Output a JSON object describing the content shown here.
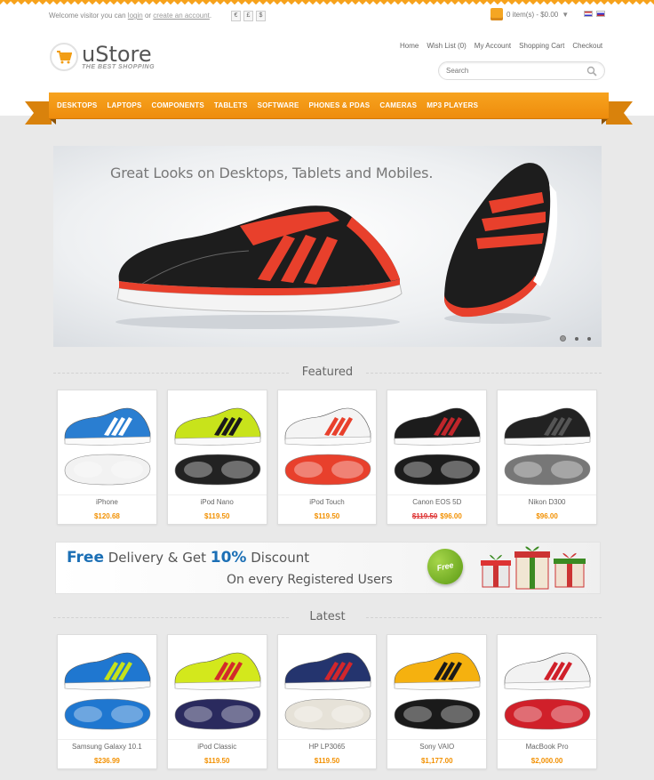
{
  "topbar": {
    "welcome_prefix": "Welcome visitor you can",
    "login_link": "login",
    "or_text": "or",
    "create_account_link": "create an account",
    "welcome_suffix": ".",
    "currencies": [
      "€",
      "£",
      "$"
    ],
    "cart_summary": "0 item(s) - $0.00"
  },
  "logo": {
    "name": "uStore",
    "tagline": "THE BEST SHOPPING"
  },
  "toplinks": [
    "Home",
    "Wish List (0)",
    "My Account",
    "Shopping Cart",
    "Checkout"
  ],
  "search": {
    "placeholder": "Search"
  },
  "nav": [
    "Desktops",
    "Laptops",
    "Components",
    "Tablets",
    "Software",
    "Phones & PDAs",
    "Cameras",
    "MP3 Players"
  ],
  "slider": {
    "caption": "Great Looks on Desktops, Tablets and Mobiles."
  },
  "featured": {
    "title": "Featured",
    "items": [
      {
        "name": "iPhone",
        "price": "$120.68",
        "old_price": "",
        "shoe_color": "#2a7ed1",
        "accent": "#ffffff",
        "sole": "#f2f2f2"
      },
      {
        "name": "iPod Nano",
        "price": "$119.50",
        "old_price": "",
        "shoe_color": "#c8e31b",
        "accent": "#1a1a1a",
        "sole": "#222222"
      },
      {
        "name": "iPod Touch",
        "price": "$119.50",
        "old_price": "",
        "shoe_color": "#f4f4f4",
        "accent": "#e8402c",
        "sole": "#e8402c"
      },
      {
        "name": "Canon EOS 5D",
        "price": "$96.00",
        "old_price": "$119.50",
        "shoe_color": "#1c1c1c",
        "accent": "#c0262b",
        "sole": "#1c1c1c"
      },
      {
        "name": "Nikon D300",
        "price": "$96.00",
        "old_price": "",
        "shoe_color": "#222222",
        "accent": "#555555",
        "sole": "#777777"
      }
    ]
  },
  "banner": {
    "free_word": "Free",
    "line1_mid": "Delivery & Get",
    "discount": "10%",
    "line1_end": "Discount",
    "line2": "On every Registered Users",
    "badge": "Free"
  },
  "latest": {
    "title": "Latest",
    "items": [
      {
        "name": "Samsung Galaxy 10.1",
        "price": "$236.99",
        "old_price": "",
        "shoe_color": "#1f77d0",
        "accent": "#c6e21a",
        "sole": "#1f77d0"
      },
      {
        "name": "iPod Classic",
        "price": "$119.50",
        "old_price": "",
        "shoe_color": "#d3e81c",
        "accent": "#d22b2b",
        "sole": "#2a2a5e"
      },
      {
        "name": "HP LP3065",
        "price": "$119.50",
        "old_price": "",
        "shoe_color": "#24346e",
        "accent": "#d2262c",
        "sole": "#e6e2d8"
      },
      {
        "name": "Sony VAIO",
        "price": "$1,177.00",
        "old_price": "",
        "shoe_color": "#f5b10f",
        "accent": "#1a1a1a",
        "sole": "#1a1a1a"
      },
      {
        "name": "MacBook Pro",
        "price": "$2,000.00",
        "old_price": "",
        "shoe_color": "#f2f2f2",
        "accent": "#d0202a",
        "sole": "#d0202a"
      }
    ]
  },
  "colors": {
    "brand_orange": "#f29d14",
    "price_orange": "#f29000",
    "banner_blue": "#1b6fb5",
    "badge_green": "#5b9a14"
  }
}
